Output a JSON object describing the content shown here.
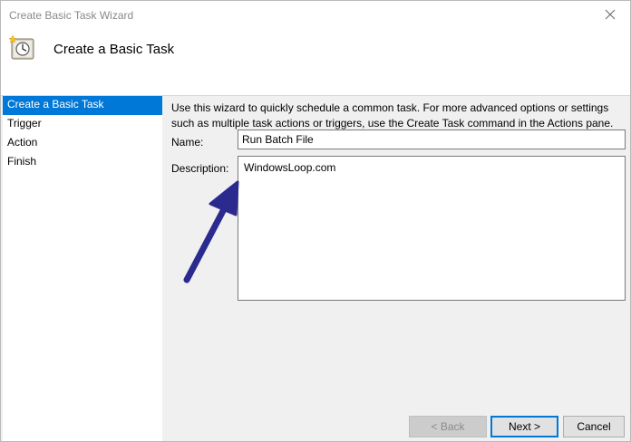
{
  "window": {
    "title": "Create Basic Task Wizard"
  },
  "header": {
    "title": "Create a Basic Task",
    "icon": "task-scheduler-clock-icon"
  },
  "sidebar": {
    "items": [
      {
        "label": "Create a Basic Task",
        "active": true
      },
      {
        "label": "Trigger",
        "active": false
      },
      {
        "label": "Action",
        "active": false
      },
      {
        "label": "Finish",
        "active": false
      }
    ]
  },
  "main": {
    "intro_line1": "Use this wizard to quickly schedule a common task.  For more advanced options or settings",
    "intro_line2": "such as multiple task actions or triggers, use the Create Task command in the Actions pane.",
    "name_label": "Name:",
    "name_value": "Run Batch File",
    "description_label": "Description:",
    "description_value": "WindowsLoop.com"
  },
  "footer": {
    "back_label": "< Back",
    "next_label": "Next >",
    "cancel_label": "Cancel"
  },
  "colors": {
    "accent": "#0078d7",
    "arrow": "#2b2a8f"
  }
}
